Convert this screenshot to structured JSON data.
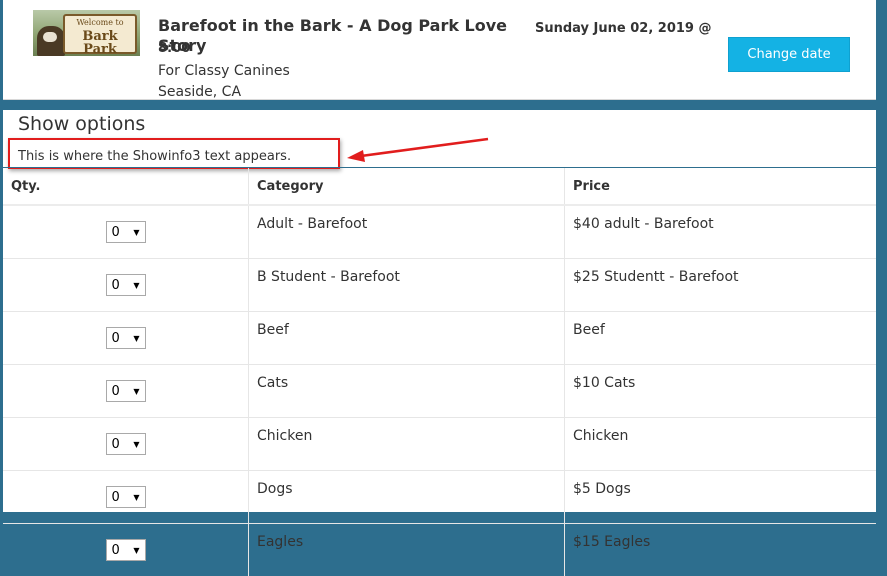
{
  "header": {
    "logo_sign_line1": "Welcome to",
    "logo_sign_line2": "Bark Park",
    "show_title": "Barefoot in the Bark - A Dog Park Love Story",
    "show_date": "Sunday June 02, 2019 @",
    "show_time": "8:00",
    "venue_line1": "For Classy Canines",
    "venue_line2": "Seaside, CA",
    "change_date_label": "Change date"
  },
  "options": {
    "title": "Show options",
    "info_text": "This is where the Showinfo3 text appears.",
    "columns": [
      "Qty.",
      "Category",
      "Price"
    ],
    "rows": [
      {
        "qty": "0",
        "category": "Adult - Barefoot",
        "price": "$40 adult - Barefoot"
      },
      {
        "qty": "0",
        "category": "B Student - Barefoot",
        "price": "$25 Studentt - Barefoot"
      },
      {
        "qty": "0",
        "category": "Beef",
        "price": "Beef"
      },
      {
        "qty": "0",
        "category": "Cats",
        "price": "$10 Cats"
      },
      {
        "qty": "0",
        "category": "Chicken",
        "price": "Chicken"
      },
      {
        "qty": "0",
        "category": "Dogs",
        "price": "$5 Dogs"
      },
      {
        "qty": "0",
        "category": "Eagles",
        "price": "$15 Eagles"
      }
    ]
  },
  "colors": {
    "background": "#2d6e8e",
    "button": "#14b2e4",
    "annotation": "#e11d1d"
  }
}
